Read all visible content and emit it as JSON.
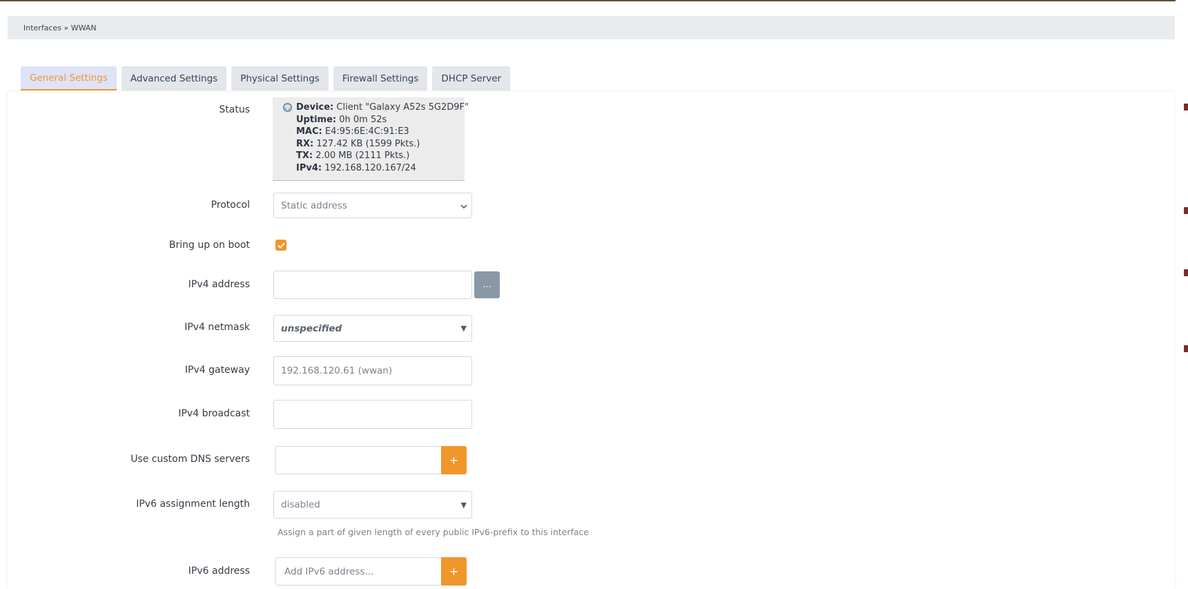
{
  "breadcrumb": {
    "text": "Interfaces » WWAN"
  },
  "tabs": [
    {
      "label": "General Settings",
      "active": true
    },
    {
      "label": "Advanced Settings",
      "active": false
    },
    {
      "label": "Physical Settings",
      "active": false
    },
    {
      "label": "Firewall Settings",
      "active": false
    },
    {
      "label": "DHCP Server",
      "active": false
    }
  ],
  "labels": {
    "status": "Status",
    "protocol": "Protocol",
    "boot": "Bring up on boot",
    "ipv4_address": "IPv4 address",
    "ipv4_netmask": "IPv4 netmask",
    "ipv4_gateway": "IPv4 gateway",
    "ipv4_broadcast": "IPv4 broadcast",
    "custom_dns": "Use custom DNS servers",
    "ipv6_assign": "IPv6 assignment length",
    "ipv6_address": "IPv6 address"
  },
  "status": {
    "icon": "wifi-client-icon",
    "device_key": "Device:",
    "device_val": "Client \"Galaxy A52s 5G2D9F\"",
    "uptime_key": "Uptime:",
    "uptime_val": "0h 0m 52s",
    "mac_key": "MAC:",
    "mac_val": "E4:95:6E:4C:91:E3",
    "rx_key": "RX:",
    "rx_val": "127.42 KB (1599 Pkts.)",
    "tx_key": "TX:",
    "tx_val": "2.00 MB (2111 Pkts.)",
    "ipv4_key": "IPv4:",
    "ipv4_val": "192.168.120.167/24"
  },
  "fields": {
    "protocol_value": "Static address",
    "boot_checked": true,
    "ipv4_address_value": "",
    "ipv4_address_button": "...",
    "ipv4_netmask_value": "unspecified",
    "ipv4_gateway_placeholder": "192.168.120.61 (wwan)",
    "ipv4_broadcast_value": "",
    "dns_value": "",
    "dns_add_button": "+",
    "ipv6_assign_value": "disabled",
    "ipv6_assign_hint": "Assign a part of given length of every public IPv6-prefix to this interface",
    "ipv6_address_placeholder": "Add IPv6 address...",
    "ipv6_add_button": "+"
  },
  "colors": {
    "accent": "#f0962c",
    "tab_bg": "#e3e6ea",
    "active_tab_bg": "#dfe3f7",
    "breadcrumb_bg": "#e9ecef",
    "status_bg": "#ececec",
    "secondary_button": "#8a97a7"
  }
}
